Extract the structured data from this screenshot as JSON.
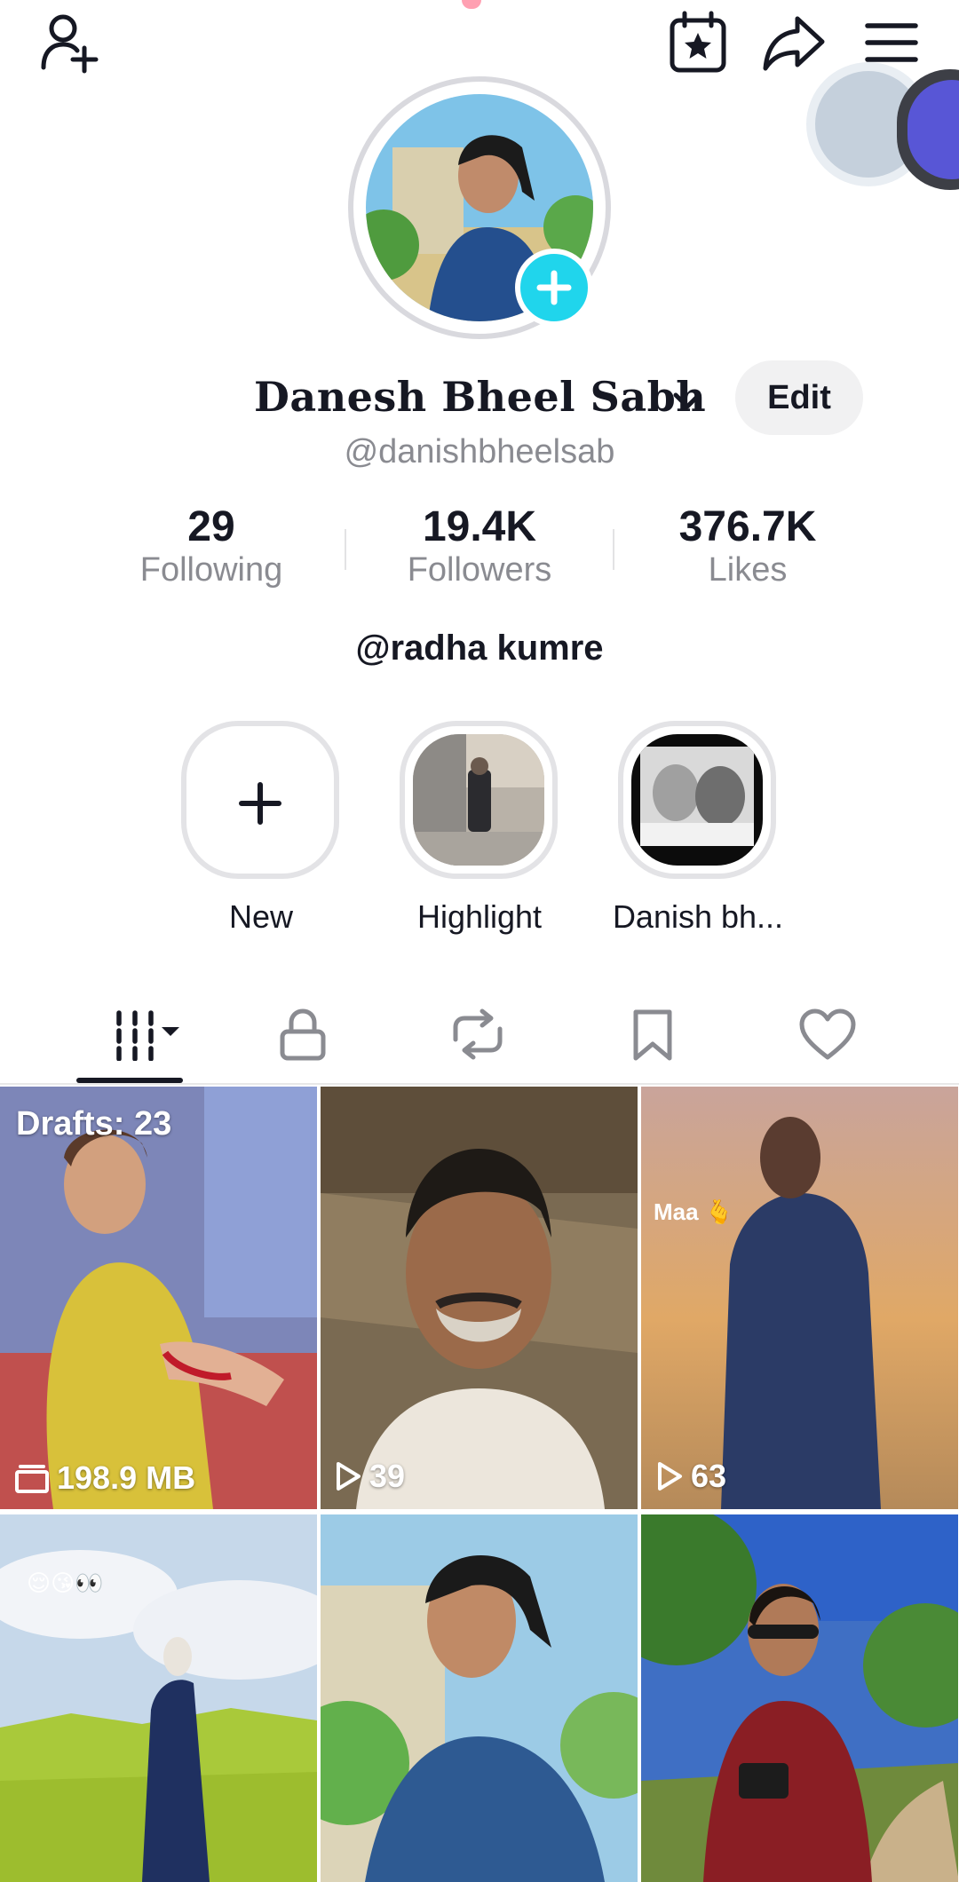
{
  "profile": {
    "display_name": "Danesh Bheel Sabh",
    "handle": "@danishbheelsab",
    "edit_label": "Edit",
    "bio": "@radha kumre"
  },
  "stats": [
    {
      "value": "29",
      "label": "Following"
    },
    {
      "value": "19.4K",
      "label": "Followers"
    },
    {
      "value": "376.7K",
      "label": "Likes"
    }
  ],
  "highlights": [
    {
      "label": "New",
      "icon": "plus-icon"
    },
    {
      "label": "Highlight"
    },
    {
      "label": "Danish bh..."
    }
  ],
  "tabs": [
    {
      "name": "videos",
      "icon": "grid-icon",
      "active": true
    },
    {
      "name": "private",
      "icon": "lock-icon"
    },
    {
      "name": "reposts",
      "icon": "repost-icon"
    },
    {
      "name": "favorites",
      "icon": "bookmark-icon"
    },
    {
      "name": "liked",
      "icon": "heart-icon"
    }
  ],
  "videos": [
    {
      "overlay": "Drafts: 23",
      "footer": "198.9 MB",
      "footer_icon": "drafts-icon"
    },
    {
      "footer": "39",
      "footer_icon": "play-icon"
    },
    {
      "caption": "Maa 🫰",
      "footer": "63",
      "footer_icon": "play-icon"
    },
    {
      "caption": "😌😘👀"
    },
    {},
    {}
  ],
  "colors": {
    "accent": "#fe2c55",
    "add_badge": "#20d5ec",
    "text_primary": "#161823",
    "text_secondary": "#8a8b91"
  }
}
